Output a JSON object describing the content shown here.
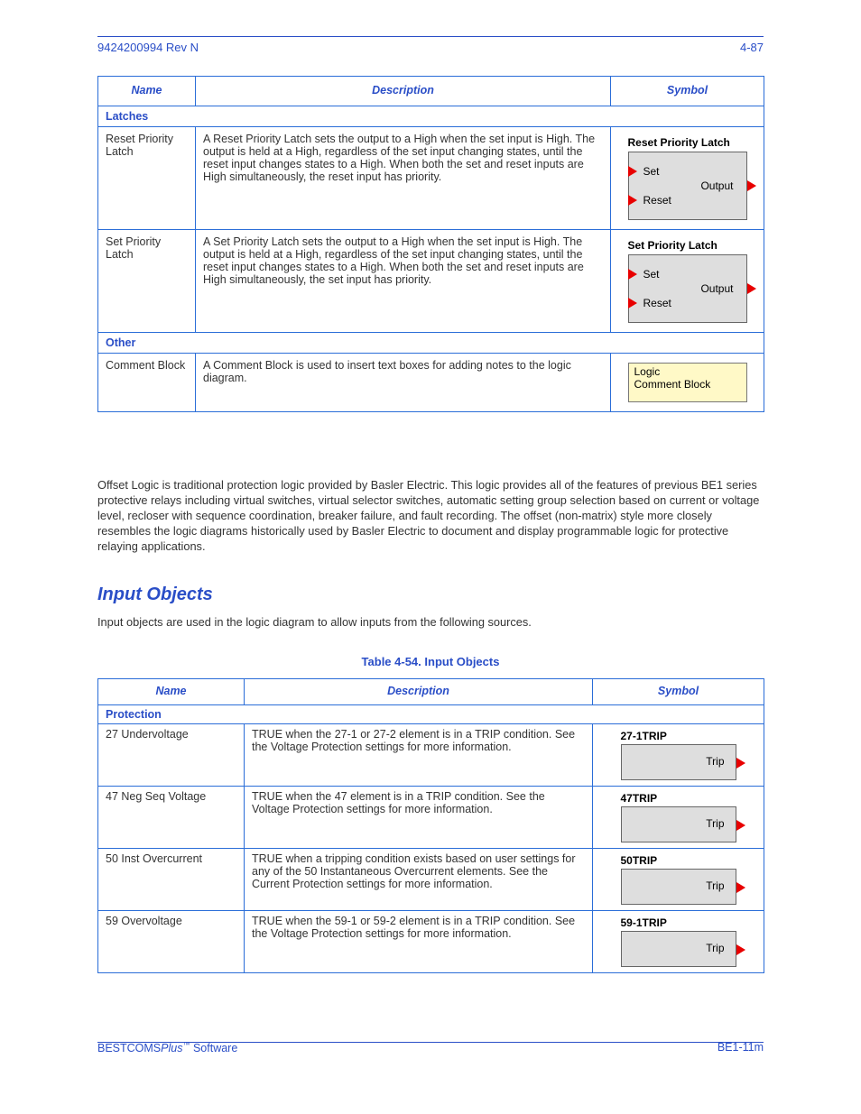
{
  "header": {
    "page_num": "4-87",
    "doc_id": "9424200994 Rev N"
  },
  "footer": {
    "left_prefix": "BESTCOMS",
    "left_tm": "Plus",
    "left_suffix": " Software",
    "right": "BE1-11m"
  },
  "table53": {
    "headers": {
      "c1": "Name",
      "c2": "Description",
      "c3": "Symbol"
    },
    "group_latches": "Latches",
    "group_other": "Other",
    "rows": {
      "reset_latch": {
        "name": "Reset Priority Latch",
        "desc": "A Reset Priority Latch sets the output to a High when the set input is High. The output is held at a High, regardless of the set input changing states, until the reset input changes states to a High. When both the set and reset inputs are High simultaneously, the reset input has priority.",
        "symbol": {
          "title": "Reset Priority Latch",
          "in1": "Set",
          "in2": "Reset",
          "out": "Output"
        }
      },
      "set_latch": {
        "name": "Set Priority Latch",
        "desc": "A Set Priority Latch sets the output to a High when the set input is High. The output is held at a High, regardless of the set input changing states, until the reset input changes states to a High. When both the set and reset inputs are High simultaneously, the set input has priority.",
        "symbol": {
          "title": "Set Priority Latch",
          "in1": "Set",
          "in2": "Reset",
          "out": "Output"
        }
      },
      "comment": {
        "name": "Comment Block",
        "desc": "A Comment Block is used to insert text boxes for adding notes to the logic diagram.",
        "symbol_line1": "Logic",
        "symbol_line2": "Comment Block"
      }
    }
  },
  "offset_logic_text": "Offset Logic is traditional protection logic provided by Basler Electric. This logic provides all of the features of previous BE1 series protective relays including virtual switches, virtual selector switches, automatic setting group selection based on current or voltage level, recloser with sequence coordination, breaker failure, and fault recording. The offset (non-matrix) style more closely resembles the logic diagrams historically used by Basler Electric to document and display programmable logic for protective relaying applications.",
  "inputs_heading": "Input Objects",
  "inputs_para": "Input objects are used in the logic diagram to allow inputs from the following sources.",
  "table54": {
    "caption": "Table 4-54. Input Objects",
    "headers": {
      "c1": "Name",
      "c2": "Description",
      "c3": "Symbol"
    },
    "group": "Protection",
    "rows": {
      "r27": {
        "name": "27 Undervoltage",
        "desc": "TRUE when the 27-1 or 27-2 element is in a TRIP condition. See the Voltage Protection settings for more information.",
        "title": "27-1TRIP",
        "out": "Trip"
      },
      "r47": {
        "name": "47 Neg Seq Voltage",
        "desc": "TRUE when the 47 element is in a TRIP condition. See the Voltage Protection settings for more information.",
        "title": "47TRIP",
        "out": "Trip"
      },
      "r50": {
        "name": "50 Inst Overcurrent",
        "desc": "TRUE when a tripping condition exists based on user settings for any of the 50 Instantaneous Overcurrent elements. See the Current Protection settings for more information.",
        "title": "50TRIP",
        "out": "Trip"
      },
      "r59": {
        "name": "59 Overvoltage",
        "desc": "TRUE when the 59-1 or 59-2 element is in a TRIP condition. See the Voltage Protection settings for more information.",
        "title": "59-1TRIP",
        "out": "Trip"
      }
    }
  }
}
